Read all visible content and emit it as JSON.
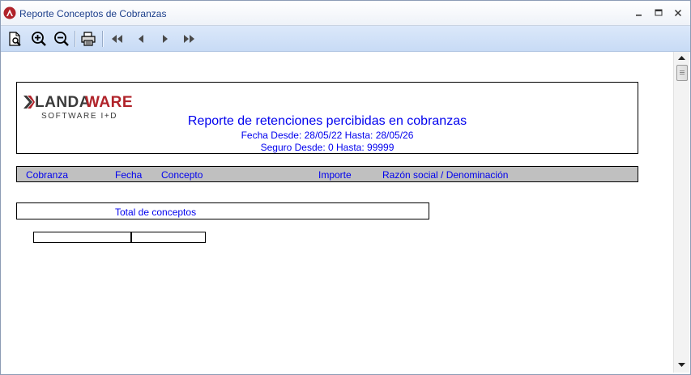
{
  "window": {
    "title": "Reporte Conceptos de Cobranzas",
    "controls": [
      "minimize",
      "maximize",
      "close"
    ]
  },
  "toolbar": {
    "buttons": [
      "page-preview-icon",
      "zoom-in-icon",
      "zoom-out-icon",
      "print-icon",
      "first-page-icon",
      "previous-page-icon",
      "next-page-icon",
      "last-page-icon"
    ]
  },
  "report": {
    "logo": {
      "brand_left": "LANDA",
      "brand_right": "WARE",
      "tagline": "SOFTWARE I+D"
    },
    "title": "Reporte de retenciones percibidas en cobranzas",
    "date_range": "Fecha Desde: 28/05/22 Hasta: 28/05/26",
    "seguro_range": "Seguro Desde: 0 Hasta: 99999",
    "columns": [
      "Cobranza",
      "Fecha",
      "Concepto",
      "Importe",
      "Razón social / Denominación"
    ],
    "total_label": "Total de conceptos"
  },
  "colors": {
    "report_text": "#0000ee",
    "logo_red": "#b0232a",
    "logo_dark": "#3a3a3a",
    "column_bar": "#c0c0c0",
    "toolbar": "#d2e2f7"
  }
}
